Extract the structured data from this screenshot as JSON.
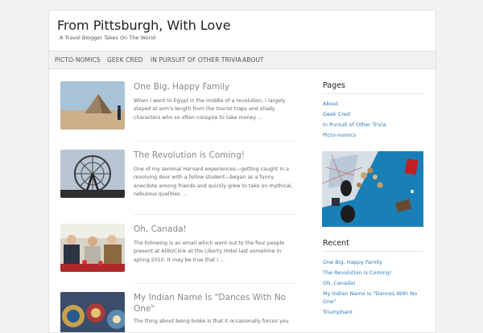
{
  "site": {
    "title": "From Pittsburgh, With Love",
    "description": "A Travel Blogger Takes On The World"
  },
  "nav": {
    "items": [
      {
        "label": "PICTO-NOMICS"
      },
      {
        "label": "GEEK CRED"
      },
      {
        "label": "IN PURSUIT OF OTHER TRIVIA"
      },
      {
        "label": "ABOUT"
      }
    ]
  },
  "posts": [
    {
      "title": "One Big, Happy Family",
      "excerpt": "When I went to Egypt in the middle of a revolution, I largely stayed at arm's-length from the tourist traps and shady characters who so often conspire to take money ..."
    },
    {
      "title": "The Revolution is Coming!",
      "excerpt": "One of my seminal Harvard experiences—getting caught in a revolving door with a fellow student—began as a funny anecdote among friends and quickly grew to take on mythical, nebulous qualities.  ..."
    },
    {
      "title": "Oh, Canada!",
      "excerpt": "The following is an email which went out to the four people present at Alibi/Clink at the Liberty Hotel last sometime in spring 2010. It may be true that I ..."
    },
    {
      "title": "My Indian Name Is \"Dances With No One\"",
      "excerpt": "The thing about being broke is that it occasionally forces you"
    }
  ],
  "sidebar": {
    "pages_title": "Pages",
    "pages": [
      {
        "label": "About"
      },
      {
        "label": "Geek Cred"
      },
      {
        "label": "In Pursuit of Other Trivia"
      },
      {
        "label": "Picto-nomics"
      }
    ],
    "recent_title": "Recent",
    "recent": [
      {
        "label": "One Big, Happy Family"
      },
      {
        "label": "The Revolution is Coming!"
      },
      {
        "label": "Oh, Canada!"
      },
      {
        "label": "My Indian Name Is \"Dances With No"
      },
      {
        "label": "One\""
      },
      {
        "label": "Triumphant"
      }
    ]
  },
  "colors": {
    "link": "#2a7ab8",
    "title": "#222222",
    "post_title": "#888888"
  }
}
